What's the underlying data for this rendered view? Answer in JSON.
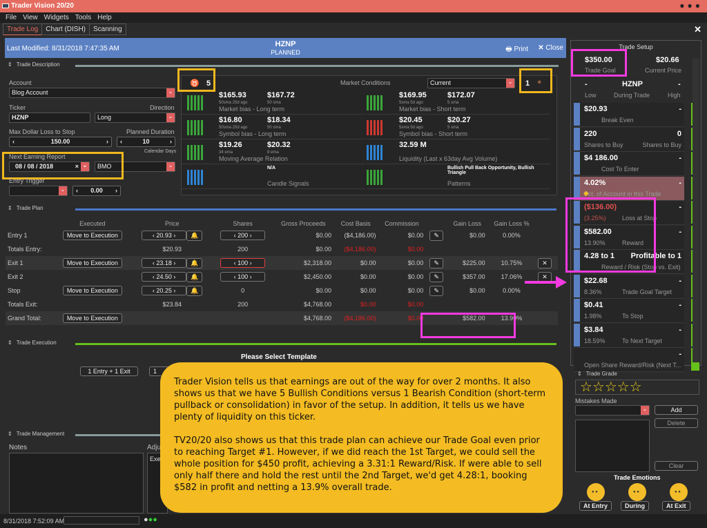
{
  "app": {
    "title": "Trader Vision 20/20",
    "menu": [
      "File",
      "View",
      "Widgets",
      "Tools",
      "Help"
    ],
    "tabs": [
      "Trade Log",
      "Chart (DISH)",
      "Scanning"
    ],
    "active_tab": 0
  },
  "header": {
    "last_modified": "Last Modified: 8/31/2018 7:47:35 AM",
    "ticker": "HZNP",
    "status": "PLANNED",
    "print": "Print",
    "close": "Close"
  },
  "trade_description": {
    "section": "Trade Description",
    "account_label": "Account",
    "account": "Blog Account",
    "ticker_label": "Ticker",
    "ticker": "HZNP",
    "direction_label": "Direction",
    "direction": "Long",
    "max_loss_label": "Max Dollar Loss to Stop",
    "max_loss": "150.00",
    "duration_label": "Planned Duration",
    "duration": "10",
    "duration_unit": "Calendar Days",
    "earning_label": "Next Earning Report",
    "earning_date": "08 / 08 / 2018",
    "earning_time": "BMO",
    "entry_trigger_label": "Entry Trigger",
    "entry_trigger_value": "0.00"
  },
  "market": {
    "bull_count": "5",
    "bear_count": "1",
    "label": "Market Conditions",
    "period": "Current",
    "left": [
      {
        "v1": "$165.93",
        "s1": "50sma 25d ago",
        "v2": "$167.72",
        "s2": "50 sma",
        "title": "Market bias - Long term",
        "icon": "bullish-chart-icon"
      },
      {
        "v1": "$16.80",
        "s1": "50sma 25d ago",
        "v2": "$18.34",
        "s2": "50 sma",
        "title": "Symbol bias - Long term",
        "icon": "bullish-chart-icon"
      },
      {
        "v1": "$19.26",
        "s1": "34 ema",
        "v2": "$20.32",
        "s2": "8 ema",
        "title": "Moving Average Relation",
        "icon": "bullish-chart-icon"
      },
      {
        "v1": "N/A",
        "title": "Candle Signals",
        "icon": "neutral-chart-icon"
      }
    ],
    "right": [
      {
        "v1": "$169.95",
        "s1": "5sma 5d ago",
        "v2": "$172.07",
        "s2": "5 sma",
        "title": "Market bias - Short term",
        "icon": "bullish-chart-icon"
      },
      {
        "v1": "$20.45",
        "s1": "5sma 5d ago",
        "v2": "$20.27",
        "s2": "5 sma",
        "title": "Symbol bias - Short term",
        "icon": "bearish-chart-icon"
      },
      {
        "v1": "32.59 M",
        "title": "Liquidity (Last x 63day Avg Volume)",
        "icon": "neutral-chart-icon"
      },
      {
        "v1": "Bullish Pull Back Opportunity, Bullish Triangle",
        "title": "Patterns",
        "icon": "bullish-chart-icon"
      }
    ]
  },
  "trade_plan": {
    "section": "Trade Plan",
    "headers": [
      "",
      "Executed",
      "Price",
      "Shares",
      "Gross Proceeds",
      "Cost Basis",
      "Commission",
      "",
      "Gain Loss",
      "Gain Loss %",
      ""
    ],
    "move_label": "Move to Execution",
    "rows": [
      {
        "name": "Entry 1",
        "price": "20.93",
        "shares": "200",
        "gross": "$0.00",
        "cost": "($4,186.00)",
        "comm": "$0.00",
        "gain": "$0.00",
        "gainpct": "0.00%"
      },
      {
        "name": "Totals Entry:",
        "price": "$20.93",
        "shares": "200",
        "gross": "$0.00",
        "cost": "($4,186.00)",
        "comm": "$0.00"
      },
      {
        "name": "Exit 1",
        "price": "23.18",
        "shares": "100",
        "gross": "$2,318.00",
        "cost": "$0.00",
        "comm": "$0.00",
        "gain": "$225.00",
        "gainpct": "10.75%"
      },
      {
        "name": "Exit 2",
        "price": "24.50",
        "shares": "100",
        "gross": "$2,450.00",
        "cost": "$0.00",
        "comm": "$0.00",
        "gain": "$357.00",
        "gainpct": "17.06%"
      },
      {
        "name": "Stop",
        "price": "20.25",
        "shares": "0",
        "gross": "$0.00",
        "cost": "$0.00",
        "comm": "$0.00",
        "gain": "$0.00",
        "gainpct": "0.00%"
      },
      {
        "name": "Totals Exit:",
        "price": "$23.84",
        "shares": "200",
        "gross": "$4,768.00",
        "cost": "$0.00",
        "comm": "$0.00"
      },
      {
        "name": "Grand Total:",
        "gross": "$4,768.00",
        "cost": "($4,186.00)",
        "comm": "$0.00",
        "gain": "$582.00",
        "gainpct": "13.90%"
      }
    ]
  },
  "trade_execution": {
    "section": "Trade Execution",
    "prompt": "Please Select Template",
    "templates": [
      "1 Entry + 1 Exit",
      "1"
    ]
  },
  "trade_management": {
    "section": "Trade Management",
    "notes": "Notes",
    "adj": "Adju",
    "exe": "Exe"
  },
  "trade_setup": {
    "title": "Trade Setup",
    "goal": "$350.00",
    "goal_label": "Trade Goal",
    "price": "$20.66",
    "price_label": "Current Price",
    "low": "-",
    "ticker": "HZNP",
    "high": "-",
    "low_label": "Low",
    "during_label": "During Trade",
    "high_label": "High",
    "rows": [
      {
        "v": "$20.93",
        "r": "-",
        "label": "Break Even"
      },
      {
        "v": "220",
        "r": "0",
        "label": "Shares to Buy",
        "rlabel": "Shares to Buy"
      },
      {
        "v": "$4 186.00",
        "r": "-",
        "label": "Cost To Enter"
      },
      {
        "v": "4.02%",
        "r": "-",
        "label": "Pct. of Account in this Trade"
      },
      {
        "v": "($136.00)",
        "r": "-",
        "sub": "(3.25%)",
        "label": "Loss at Stop"
      },
      {
        "v": "$582.00",
        "r": "-",
        "sub": "13.90%",
        "label": "Reward"
      },
      {
        "v": "4.28 to 1",
        "r": "Profitable to 1",
        "label": "Reward / Risk (Stop vs. Exit)"
      },
      {
        "v": "$22.68",
        "r": "-",
        "sub": "8.36%",
        "label": "Trade Goal Target"
      },
      {
        "v": "$0.41",
        "r": "-",
        "sub": "1.98%",
        "label": "To Stop"
      },
      {
        "v": "$3.84",
        "r": "-",
        "sub": "18.59%",
        "label": "To Next Target"
      },
      {
        "v": "",
        "r": "-",
        "label": "Open Share Reward/Risk (Next T..."
      }
    ]
  },
  "trade_grade": {
    "section": "Trade Grade",
    "stars": "☆☆☆☆☆",
    "mistakes": "Mistakes Made",
    "add": "Add",
    "delete": "Delete",
    "clear": "Clear",
    "emotions": "Trade Emotions",
    "emo": [
      "At Entry",
      "During",
      "At Exit"
    ]
  },
  "note": {
    "p1": "Trader Vision tells us that earnings are out of the way for over 2 months.  It also shows us that we have 5 Bullish Conditions versus 1 Bearish Condition (short-term pullback or consolidation) in favor of the setup.  In addition, it tells us we have plenty of liquidity on this ticker.",
    "p2": "TV20/20 also shows us that this trade plan can achieve our Trade Goal even prior to reaching Target #1.  However, if we did reach the 1st Target, we could sell the whole position for $450 profit, achieving a 3.31:1 Reward/Risk.  If were able to sell only half there and hold the rest until the 2nd Target, we'd get 4.28:1, booking $582 in profit and netting a 13.9% overall trade."
  },
  "status": {
    "time": "8/31/2018 7:52:09 AM"
  },
  "colors": {
    "accent": "#e46c60",
    "header": "#5b81c3",
    "highlight_yellow": "#f1b71e",
    "highlight_pink": "#f43ae0",
    "green": "#66c11a"
  }
}
